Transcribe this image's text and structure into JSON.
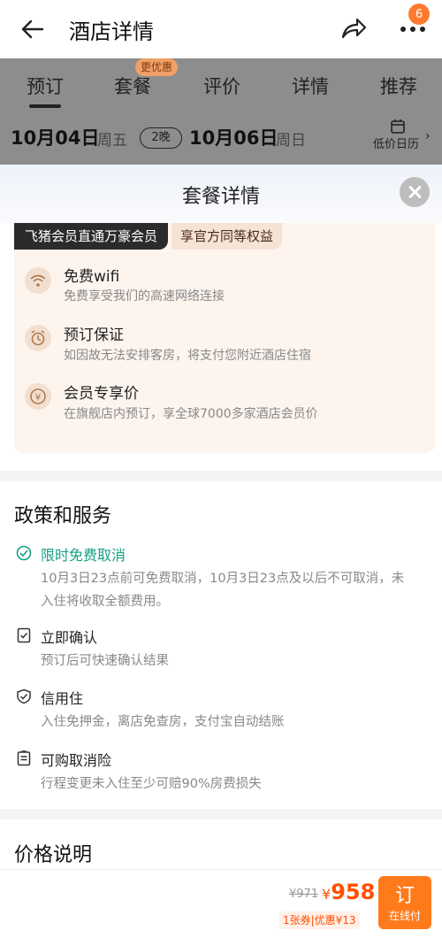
{
  "header": {
    "title": "酒店详情",
    "badge_count": "6"
  },
  "tabs": {
    "items": [
      "预订",
      "套餐",
      "评价",
      "详情",
      "推荐"
    ],
    "promo": "更优惠"
  },
  "dates": {
    "checkin_day": "10月04日",
    "checkin_weekday": "周五",
    "nights": "2晚",
    "checkout_day": "10月06日",
    "checkout_weekday": "周日",
    "calendar_label": "低价日历"
  },
  "sheet": {
    "title": "套餐详情"
  },
  "member": {
    "tag": "飞猪会员直通万豪会员",
    "tag2": "享官方同等权益",
    "benefits": [
      {
        "title": "免费wifi",
        "desc": "免费享受我们的高速网络连接",
        "icon": "wifi-icon"
      },
      {
        "title": "预订保证",
        "desc": "如因故无法安排客房，将支付您附近酒店住宿",
        "icon": "alarm-clock-icon"
      },
      {
        "title": "会员专享价",
        "desc": "在旗舰店内预订，享全球7000多家酒店会员价",
        "icon": "yen-coin-icon"
      }
    ]
  },
  "policy": {
    "title": "政策和服务",
    "items": [
      {
        "title": "限时免费取消",
        "desc": "10月3日23点前可免费取消，10月3日23点及以后不可取消，未入住将收取全额费用。",
        "icon": "check-circle-icon"
      },
      {
        "title": "立即确认",
        "desc": "预订后可快速确认结果",
        "icon": "confirm-doc-icon"
      },
      {
        "title": "信用住",
        "desc": "入住免押金，离店免查房，支付宝自动结账",
        "icon": "shield-icon"
      },
      {
        "title": "可购取消险",
        "desc": "行程变更未入住至少可赔90%房费损失",
        "icon": "insurance-doc-icon"
      }
    ]
  },
  "price_section": {
    "title": "价格说明"
  },
  "bottom_bar": {
    "old_price": "¥971",
    "currency": "¥",
    "price": "958",
    "coupon": "1张券|优惠¥13",
    "book_label": "订",
    "book_sub": "在线付"
  },
  "colors": {
    "accent": "#ff7a1a",
    "price": "#ff5000",
    "green": "#16a085"
  }
}
